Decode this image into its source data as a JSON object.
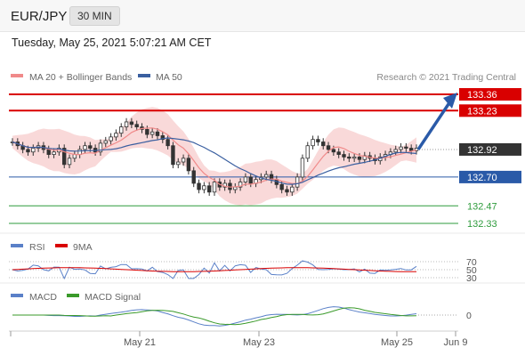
{
  "header": {
    "pair": "EUR/JPY",
    "timeframe": "30 MIN"
  },
  "datetime": "Tuesday, May 25, 2021 5:07:21 AM CET",
  "legend": {
    "ma20": "MA 20 + Bollinger Bands",
    "ma50": "MA 50",
    "credit": "Research © 2021 Trading Central"
  },
  "rsi_legend": {
    "rsi": "RSI",
    "ma": "9MA"
  },
  "macd_legend": {
    "macd": "MACD",
    "signal": "MACD Signal"
  },
  "colors": {
    "resistance": "#d90000",
    "pivot": "#2a5aa8",
    "support": "#2e9b3c",
    "ma20": "#f08a8a",
    "ma50": "#3a5fa0",
    "bollinger": "#f7c9c9",
    "rsi": "#5a80c8",
    "macd": "#5a80c8",
    "signal": "#3a9a2a",
    "price": "#333333"
  },
  "chart_data": {
    "type": "candlestick",
    "x_ticks": [
      "May 21",
      "May 23",
      "May 25",
      "Jun 9"
    ],
    "price_levels": [
      {
        "value": 133.36,
        "label": "133.36",
        "kind": "resistance"
      },
      {
        "value": 133.23,
        "label": "133.23",
        "kind": "resistance"
      },
      {
        "value": 132.92,
        "label": "132.92",
        "kind": "last"
      },
      {
        "value": 132.7,
        "label": "132.70",
        "kind": "pivot"
      },
      {
        "value": 132.47,
        "label": "132.47",
        "kind": "support"
      },
      {
        "value": 132.33,
        "label": "132.33",
        "kind": "support"
      }
    ],
    "close_path": [
      132.98,
      132.95,
      132.92,
      132.9,
      132.93,
      132.95,
      132.92,
      132.88,
      132.9,
      132.93,
      132.8,
      132.85,
      132.88,
      132.92,
      132.95,
      132.93,
      132.9,
      132.97,
      132.99,
      133.02,
      133.05,
      133.1,
      133.14,
      133.12,
      133.1,
      133.08,
      133.04,
      133.06,
      133.03,
      133.0,
      132.95,
      132.8,
      132.82,
      132.85,
      132.75,
      132.65,
      132.6,
      132.63,
      132.58,
      132.66,
      132.62,
      132.65,
      132.6,
      132.62,
      132.66,
      132.7,
      132.65,
      132.68,
      132.7,
      132.72,
      132.68,
      132.64,
      132.6,
      132.58,
      132.62,
      132.7,
      132.85,
      132.95,
      133.0,
      132.98,
      132.95,
      132.92,
      132.9,
      132.88,
      132.86,
      132.85,
      132.86,
      132.84,
      132.87,
      132.85,
      132.83,
      132.86,
      132.88,
      132.9,
      132.92,
      132.94,
      132.93,
      132.91,
      132.93
    ],
    "forecast": {
      "from": 132.92,
      "to": 133.36
    },
    "rsi": {
      "levels": [
        70,
        50,
        30
      ]
    },
    "macd": {
      "levels": [
        0
      ]
    }
  }
}
